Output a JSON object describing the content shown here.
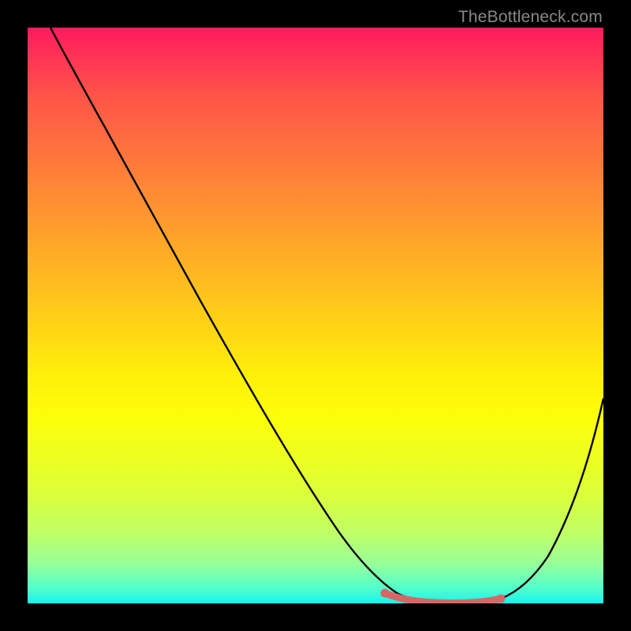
{
  "watermark": "TheBottleneck.com",
  "chart_data": {
    "type": "line",
    "title": "",
    "xlabel": "",
    "ylabel": "",
    "xlim": [
      0,
      100
    ],
    "ylim": [
      0,
      100
    ],
    "background_gradient": "red-yellow-green vertical gradient",
    "series": [
      {
        "name": "bottleneck-curve",
        "color": "#000000",
        "x": [
          4,
          8,
          14,
          20,
          28,
          36,
          44,
          52,
          58,
          62,
          66,
          70,
          75,
          80,
          85,
          90,
          95,
          100
        ],
        "y": [
          100,
          94,
          85,
          76,
          64,
          52,
          40,
          28,
          18,
          10,
          4,
          0.5,
          0,
          0,
          0.5,
          6,
          18,
          38
        ]
      },
      {
        "name": "highlight-segment",
        "color": "#d96666",
        "stroke_width_px": 8,
        "x": [
          62,
          70,
          76,
          82
        ],
        "y": [
          2,
          0.4,
          0,
          0.6
        ]
      }
    ],
    "annotations": []
  }
}
